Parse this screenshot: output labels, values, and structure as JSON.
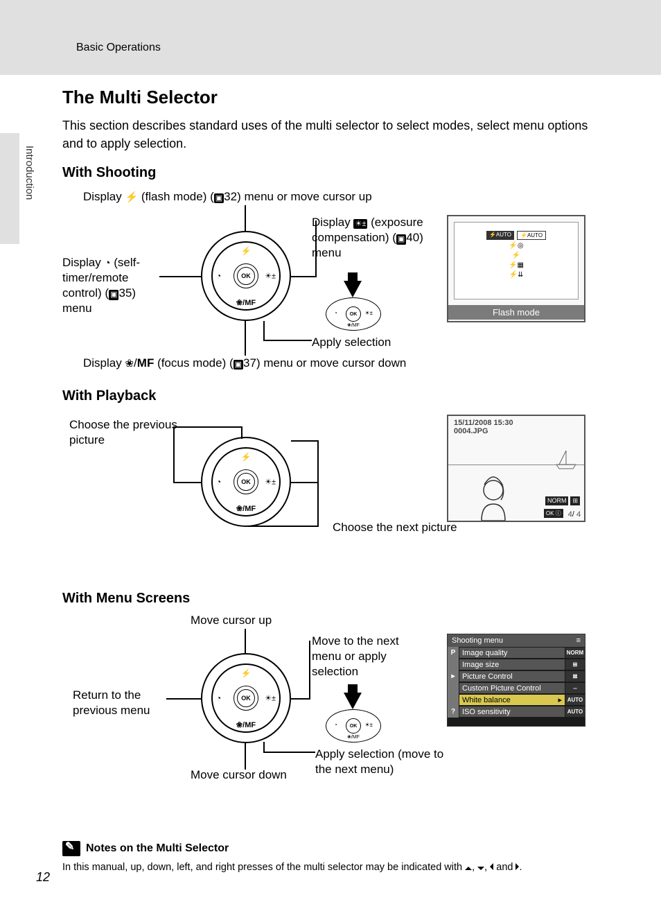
{
  "header": "Basic Operations",
  "sideTab": "Introduction",
  "pageNumber": "12",
  "title": "The Multi Selector",
  "intro": "This section describes standard uses of the multi selector to select modes, select menu options and to apply selection.",
  "shooting": {
    "heading": "With Shooting",
    "up_pre": "Display ",
    "up_post": " (flash mode) (",
    "up_ref": "32",
    "up_end": ") menu or move cursor up",
    "left_pre": "Display ",
    "left_mid": " (self-timer/remote control) (",
    "left_ref": "35",
    "left_end": ") menu",
    "right_pre": "Display ",
    "right_mid": " (exposure compensation) (",
    "right_ref": "40",
    "right_end": ") menu",
    "apply": "Apply selection",
    "down_pre": "Display ",
    "down_mid": "/",
    "down_mf": "MF",
    "down_mid2": " (focus mode) (",
    "down_ref": "37",
    "down_end": ") menu or move cursor down",
    "screen_label": "Flash mode",
    "screen_items": [
      "⚡AUTO",
      "⚡◎",
      "⚡",
      "⚡▦",
      "⚡⇊"
    ],
    "screen_top_right": "⚡AUTO"
  },
  "playback": {
    "heading": "With Playback",
    "prev": "Choose the previous picture",
    "next": "Choose the next picture",
    "date": "15/11/2008 15:30",
    "file": "0004.JPG",
    "badge": "NORM",
    "counter": "4/    4"
  },
  "menus": {
    "heading": "With Menu Screens",
    "up": "Move cursor up",
    "down": "Move cursor down",
    "left": "Return to the previous menu",
    "right": "Move to the next menu or apply selection",
    "apply": "Apply selection (move to the next menu)",
    "screen_title": "Shooting menu",
    "rows": [
      {
        "tab": "P",
        "label": "Image quality",
        "val": "NORM"
      },
      {
        "tab": "",
        "label": "Image size",
        "val": "⊞"
      },
      {
        "tab": "▸",
        "label": "Picture Control",
        "val": "⊠"
      },
      {
        "tab": "",
        "label": "Custom Picture Control",
        "val": "--"
      },
      {
        "tab": "",
        "label": "White balance",
        "val": "AUTO",
        "hl": true
      },
      {
        "tab": "?",
        "label": "ISO sensitivity",
        "val": "AUTO"
      }
    ]
  },
  "notes": {
    "heading": "Notes on the Multi Selector",
    "body_pre": "In this manual, up, down, left, and right presses of the multi selector may be indicated with ",
    "body_post": "."
  },
  "dial": {
    "ok": "OK",
    "bottom": "❀/MF",
    "flash": "⚡",
    "timer": "◔",
    "exp": "☀±"
  }
}
